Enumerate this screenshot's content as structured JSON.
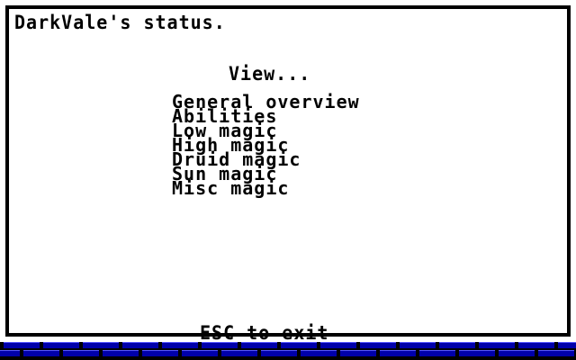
{
  "window": {
    "title": "DarkVale's status."
  },
  "menu": {
    "heading": "View...",
    "items": [
      {
        "label": "General overview"
      },
      {
        "label": "Abilities"
      },
      {
        "label": "Low magic"
      },
      {
        "label": "High magic"
      },
      {
        "label": "Druid magic"
      },
      {
        "label": "Sun magic"
      },
      {
        "label": "Misc magic"
      }
    ]
  },
  "footer": {
    "exit_hint": "ESC to exit"
  },
  "colors": {
    "panel": "#ffffff",
    "text": "#000000",
    "background": "#000000",
    "brick": "#0000aa"
  }
}
